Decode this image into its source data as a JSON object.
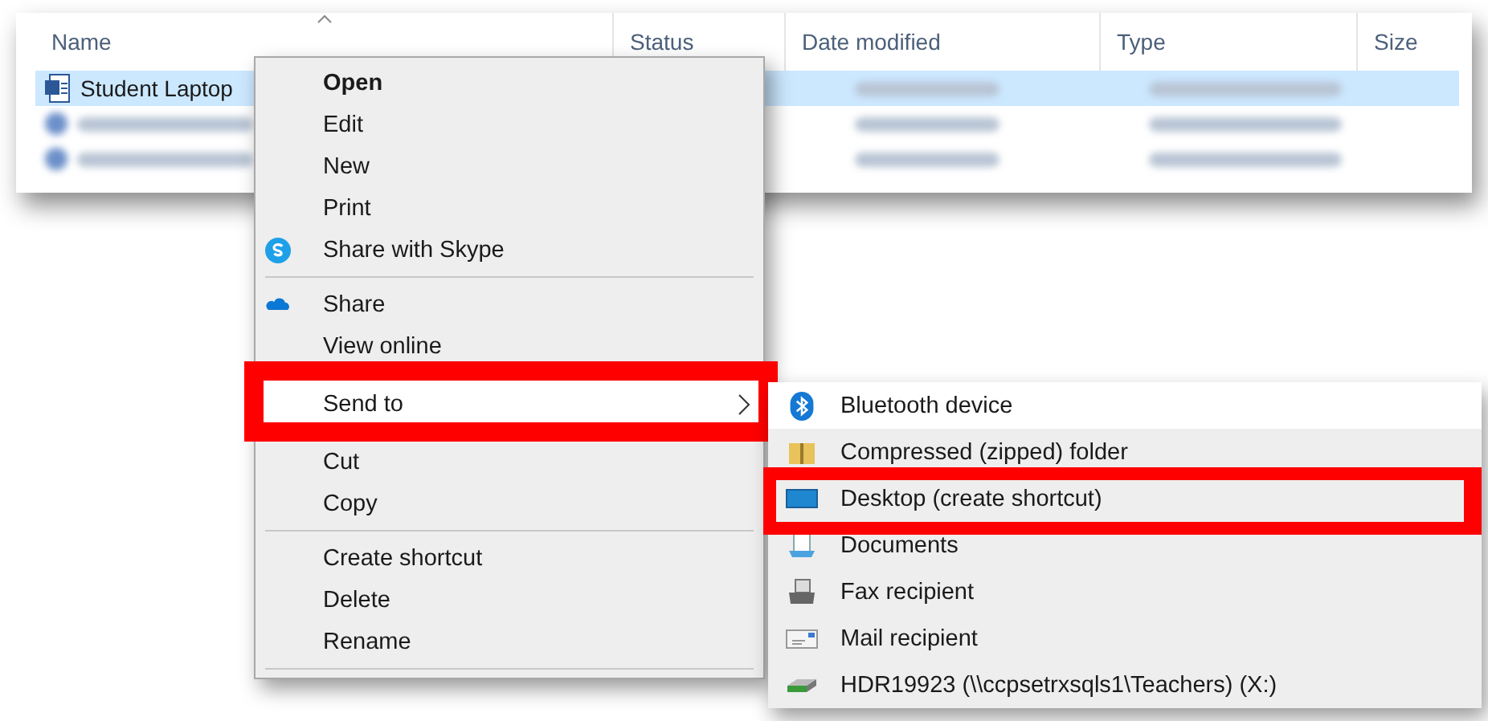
{
  "explorer": {
    "columns": [
      {
        "label": "Name",
        "sorted": true
      },
      {
        "label": "Status",
        "sorted": false
      },
      {
        "label": "Date modified",
        "sorted": false
      },
      {
        "label": "Type",
        "sorted": false
      },
      {
        "label": "Size",
        "sorted": false
      }
    ],
    "rows": [
      {
        "name": "Student Laptop",
        "selected": true
      },
      {
        "selected": false
      },
      {
        "selected": false
      }
    ]
  },
  "context_menu": {
    "items": [
      {
        "kind": "item",
        "label": "Open",
        "default": true,
        "selected": false
      },
      {
        "kind": "item",
        "label": "Edit",
        "selected": false
      },
      {
        "kind": "item",
        "label": "New",
        "selected": false
      },
      {
        "kind": "item",
        "label": "Print",
        "selected": false
      },
      {
        "kind": "item",
        "label": "Share with Skype",
        "selected": false
      },
      {
        "kind": "separator"
      },
      {
        "kind": "item",
        "label": "Share",
        "selected": false
      },
      {
        "kind": "item",
        "label": "View online",
        "selected": false
      },
      {
        "kind": "item",
        "label": "Send to",
        "submenu": true,
        "highlight": true,
        "selected": true
      },
      {
        "kind": "item",
        "label": "Cut",
        "selected": false
      },
      {
        "kind": "item",
        "label": "Copy",
        "selected": false
      },
      {
        "kind": "separator"
      },
      {
        "kind": "item",
        "label": "Create shortcut",
        "selected": false
      },
      {
        "kind": "item",
        "label": "Delete",
        "selected": false
      },
      {
        "kind": "item",
        "label": "Rename",
        "selected": false
      },
      {
        "kind": "separator"
      }
    ]
  },
  "send_to_menu": {
    "items": [
      {
        "label": "Bluetooth device",
        "selected": true
      },
      {
        "label": "Compressed (zipped) folder",
        "selected": false
      },
      {
        "label": "Desktop (create shortcut)",
        "highlight": true,
        "selected": false
      },
      {
        "label": "Documents",
        "selected": false
      },
      {
        "label": "Fax recipient",
        "selected": false
      },
      {
        "label": "Mail recipient",
        "selected": false
      },
      {
        "label": "HDR19923 (\\\\ccpsetrxsqls1\\Teachers) (X:)",
        "selected": false
      }
    ]
  }
}
